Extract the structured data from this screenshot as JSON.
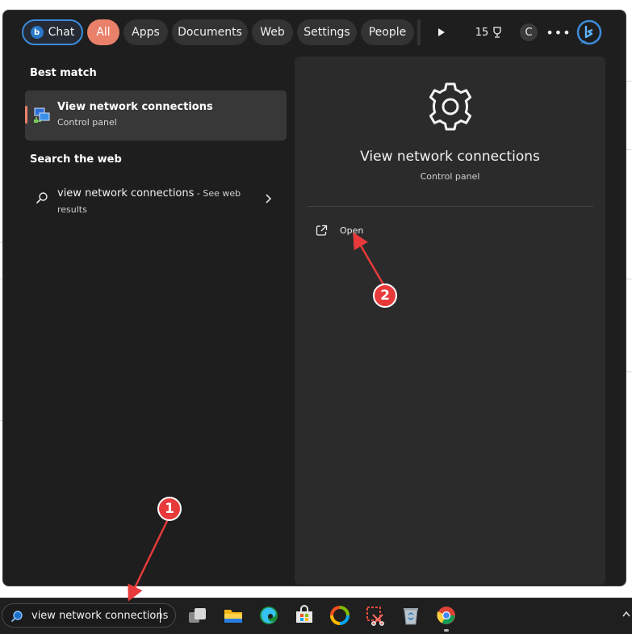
{
  "top_bar": {
    "chips": [
      {
        "id": "chat",
        "label": "Chat"
      },
      {
        "id": "all",
        "label": "All"
      },
      {
        "id": "apps",
        "label": "Apps"
      },
      {
        "id": "documents",
        "label": "Documents"
      },
      {
        "id": "web",
        "label": "Web"
      },
      {
        "id": "settings",
        "label": "Settings"
      },
      {
        "id": "people",
        "label": "People"
      }
    ],
    "rewards_points": "15",
    "profile_initial": "C"
  },
  "results": {
    "best_match_heading": "Best match",
    "best_match": {
      "title": "View network connections",
      "subtitle": "Control panel",
      "icon": "network-connections-icon"
    },
    "web_heading": "Search the web",
    "web_result": {
      "query": "view network connections",
      "suffix": " - See web results"
    }
  },
  "detail": {
    "title": "View network connections",
    "subtitle": "Control panel",
    "icon": "gear-icon",
    "actions": [
      {
        "label": "Open",
        "icon": "open-external-icon"
      }
    ]
  },
  "taskbar": {
    "search_value": "view network connections",
    "apps": [
      "task-view-icon",
      "file-explorer-icon",
      "edge-icon",
      "store-icon",
      "photos-icon",
      "snipping-tool-icon",
      "recycle-bin-icon",
      "chrome-icon"
    ]
  },
  "annotations": {
    "badge_1": "1",
    "badge_2": "2",
    "color": "#e83a3a"
  },
  "colors": {
    "accent": "#e9816a",
    "panel_bg": "#1e1e1e",
    "detail_bg": "#2b2b2b",
    "chat_border": "#3d8bdb"
  }
}
